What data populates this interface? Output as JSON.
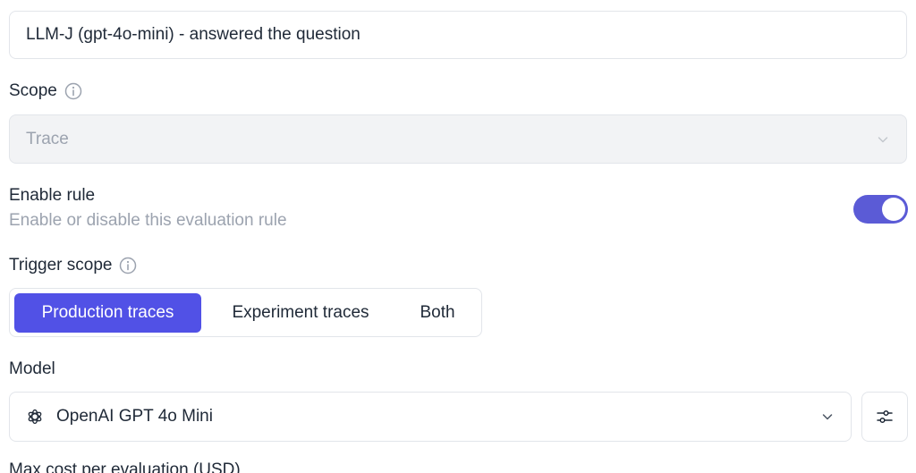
{
  "rule_name": {
    "value": "LLM-J (gpt-4o-mini) - answered the question"
  },
  "scope": {
    "label": "Scope",
    "selected": "Trace"
  },
  "enable_rule": {
    "label": "Enable rule",
    "description": "Enable or disable this evaluation rule",
    "enabled": true
  },
  "trigger_scope": {
    "label": "Trigger scope",
    "options": [
      "Production traces",
      "Experiment traces",
      "Both"
    ],
    "selected": "Production traces"
  },
  "model": {
    "label": "Model",
    "selected": "OpenAI GPT 4o Mini",
    "icon": "openai-icon"
  },
  "max_cost": {
    "label": "Max cost per evaluation (USD)"
  },
  "colors": {
    "accent": "#5151e6",
    "toggle_on": "#5b5bd6",
    "muted_text": "#9ca3af",
    "border": "#e2e5ea"
  }
}
